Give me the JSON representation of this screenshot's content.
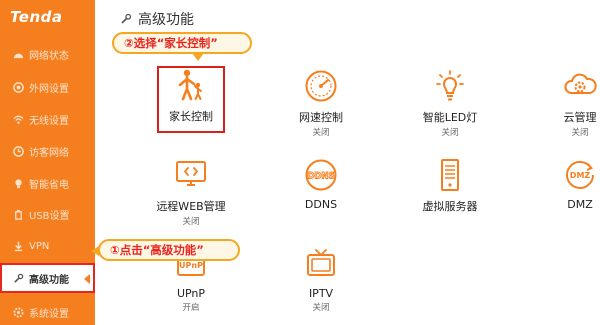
{
  "brand": {
    "logo_text": "Tenda",
    "accent": "#f57f1f",
    "highlight": "#e8261e"
  },
  "sidebar": {
    "items": [
      {
        "label": "网络状态",
        "icon": "dashboard-icon"
      },
      {
        "label": "外网设置",
        "icon": "globe-icon"
      },
      {
        "label": "无线设置",
        "icon": "wifi-icon"
      },
      {
        "label": "访客网络",
        "icon": "guest-icon"
      },
      {
        "label": "智能省电",
        "icon": "bulb-icon"
      },
      {
        "label": "USB设置",
        "icon": "usb-icon"
      },
      {
        "label": "VPN",
        "icon": "vpn-icon"
      },
      {
        "label": "高级功能",
        "icon": "wrench-icon",
        "active": true
      },
      {
        "label": "系统设置",
        "icon": "gear-icon"
      }
    ]
  },
  "header": {
    "title": "高级功能"
  },
  "tiles": [
    {
      "name": "家长控制",
      "status": "",
      "icon": "parent-child-icon"
    },
    {
      "name": "网速控制",
      "status": "关闭",
      "icon": "speedometer-icon"
    },
    {
      "name": "智能LED灯",
      "status": "关闭",
      "icon": "led-bulb-icon"
    },
    {
      "name": "云管理",
      "status": "关闭",
      "icon": "cloud-gear-icon"
    },
    {
      "name": "远程WEB管理",
      "status": "关闭",
      "icon": "monitor-code-icon"
    },
    {
      "name": "DDNS",
      "status": "",
      "icon": "ddns-icon"
    },
    {
      "name": "虚拟服务器",
      "status": "",
      "icon": "server-icon"
    },
    {
      "name": "DMZ",
      "status": "",
      "icon": "dmz-icon"
    },
    {
      "name": "UPnP",
      "status": "开启",
      "icon": "upnp-icon"
    },
    {
      "name": "IPTV",
      "status": "关闭",
      "icon": "tv-icon"
    }
  ],
  "callouts": {
    "step1": "①点击“高级功能”",
    "step2": "②选择“家长控制”"
  }
}
